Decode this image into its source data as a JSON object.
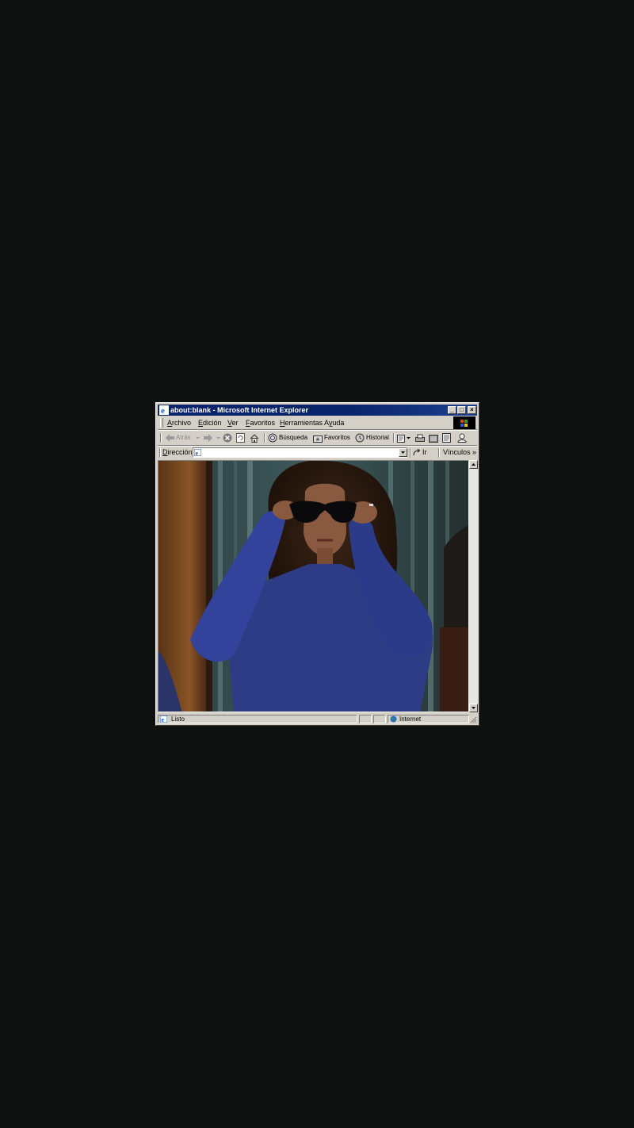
{
  "window": {
    "title": "about:blank - Microsoft Internet Explorer",
    "minimize": "_",
    "maximize": "□",
    "close": "×"
  },
  "menu": {
    "items": [
      {
        "label": "Archivo",
        "accel": "A",
        "rest": "rchivo"
      },
      {
        "label": "Edición",
        "accel": "E",
        "rest": "dición"
      },
      {
        "label": "Ver",
        "accel": "V",
        "rest": "er"
      },
      {
        "label": "Favoritos",
        "accel": "F",
        "rest": "avoritos"
      },
      {
        "label": "Herramientas",
        "accel": "H",
        "rest": "erramientas"
      },
      {
        "label": "Ayuda",
        "accel": "y",
        "pre": "A",
        "rest": "uda"
      }
    ]
  },
  "toolbar": {
    "back": "Atrás",
    "search": "Búsqueda",
    "favorites": "Favoritos",
    "history": "Historial"
  },
  "address": {
    "label_accel": "D",
    "label_rest": "irección",
    "value": "",
    "go": "Ir",
    "links": "Vínculos",
    "links_more": "»"
  },
  "content": {
    "image_description_colors": {
      "background_door": "#7a4a22",
      "curtain": "#3c5a5e",
      "sweater": "#2e3c86",
      "hair": "#2a1a12",
      "skin": "#8a5a40"
    }
  },
  "status": {
    "text": "Listo",
    "zone": "Internet"
  }
}
